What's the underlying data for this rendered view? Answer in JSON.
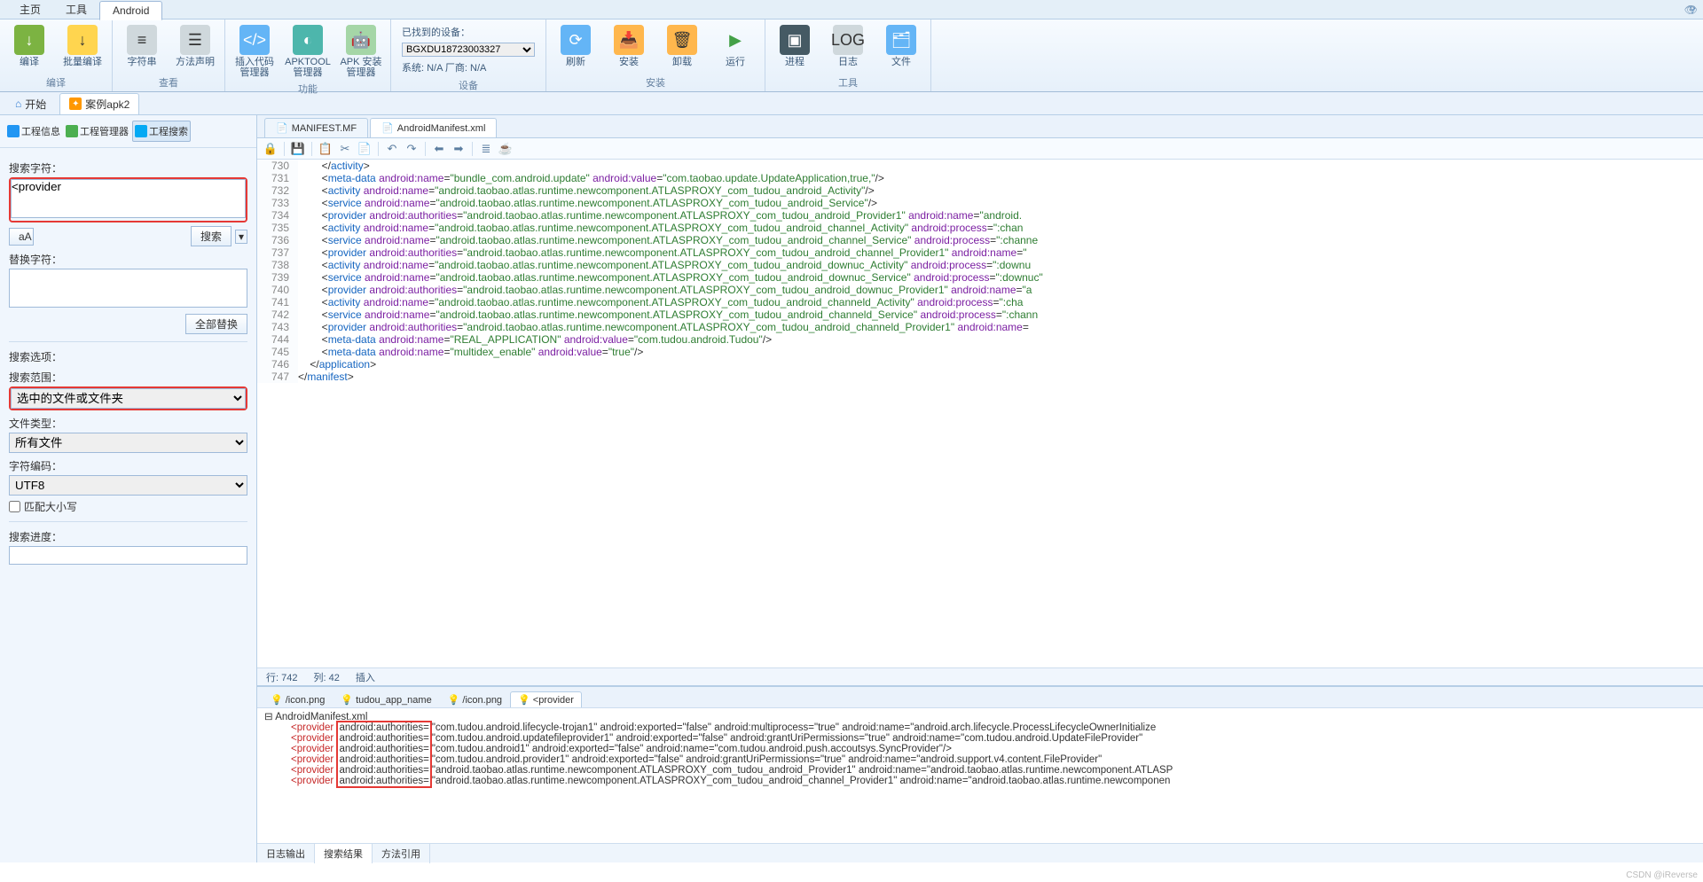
{
  "menu": {
    "home": "主页",
    "tools": "工具",
    "android": "Android"
  },
  "ribbon": {
    "groups": {
      "compile": "编译",
      "view": "查看",
      "func": "功能",
      "device": "设备",
      "install": "安装",
      "tools": "工具"
    },
    "btn": {
      "compile": "编译",
      "batch": "批量编译",
      "strings": "字符串",
      "method": "方法声明",
      "code": "插入代码管理器",
      "apktool": "APKTOOL管理器",
      "apkinst": "APK 安装管理器",
      "refresh": "刷新",
      "install": "安装",
      "uninstall": "卸载",
      "run": "运行",
      "process": "进程",
      "log": "日志",
      "file": "文件"
    },
    "device": {
      "label": "已找到的设备：",
      "selected": "BGXDU18723003327",
      "sys": "系统: N/A  厂商: N/A"
    }
  },
  "nav": {
    "start": "开始",
    "proj": "案例apk2"
  },
  "side": {
    "tabs": {
      "info": "工程信息",
      "mgr": "工程管理器",
      "search": "工程搜索"
    },
    "searchLabel": "搜索字符：",
    "searchValue": "<provider",
    "fontBtn": "aA",
    "searchBtn": "搜索",
    "replaceLabel": "替换字符：",
    "replaceAll": "全部替换",
    "optHeader": "搜索选项：",
    "scopeLabel": "搜索范围：",
    "scope": "选中的文件或文件夹",
    "ftypeLabel": "文件类型：",
    "ftype": "所有文件",
    "encLabel": "字符编码：",
    "enc": "UTF8",
    "matchcase": "匹配大小写",
    "progress": "搜索进度："
  },
  "files": {
    "tab1": "MANIFEST.MF",
    "tab2": "AndroidManifest.xml"
  },
  "status": {
    "row": "行: 742",
    "col": "列: 42",
    "mode": "插入"
  },
  "searchtabs": {
    "t1": "/icon.png",
    "t2": "tudou_app_name",
    "t3": "/icon.png",
    "t4": "<provider"
  },
  "resultFile": "AndroidManifest.xml",
  "results": [
    {
      "auth": "com.tudou.android.lifecycle-trojan1",
      "rest": "android:exported=\"false\" android:multiprocess=\"true\" android:name=\"android.arch.lifecycle.ProcessLifecycleOwnerInitialize"
    },
    {
      "auth": "com.tudou.android.updatefileprovider1",
      "rest": "android:exported=\"false\" android:grantUriPermissions=\"true\" android:name=\"com.tudou.android.UpdateFileProvider\""
    },
    {
      "auth": "com.tudou.android1",
      "rest": "android:exported=\"false\" android:name=\"com.tudou.android.push.accoutsys.SyncProvider\"/>"
    },
    {
      "auth": "com.tudou.android.provider1",
      "rest": "android:exported=\"false\" android:grantUriPermissions=\"true\" android:name=\"android.support.v4.content.FileProvider\""
    },
    {
      "auth": "android.taobao.atlas.runtime.newcomponent.ATLASPROXY_com_tudou_android_Provider1",
      "rest": "android:name=\"android.taobao.atlas.runtime.newcomponent.ATLASP"
    },
    {
      "auth": "android.taobao.atlas.runtime.newcomponent.ATLASPROXY_com_tudou_android_channel_Provider1",
      "rest": "android:name=\"android.taobao.atlas.runtime.newcomponen"
    }
  ],
  "bottomtabs": {
    "log": "日志输出",
    "res": "搜索结果",
    "ref": "方法引用"
  },
  "watermark": "CSDN @iReverse",
  "code": [
    {
      "n": 730,
      "h": "        &lt;/<span class='t-tag'>activity</span>&gt;"
    },
    {
      "n": 731,
      "h": "        &lt;<span class='t-tag'>meta-data</span> <span class='t-attr'>android:name</span>=<span class='t-str'>\"bundle_com.android.update\"</span> <span class='t-attr'>android:value</span>=<span class='t-str'>\"com.taobao.update.UpdateApplication,true,\"</span>/&gt;"
    },
    {
      "n": 732,
      "h": "        &lt;<span class='t-tag'>activity</span> <span class='t-attr'>android:name</span>=<span class='t-str'>\"android.taobao.atlas.runtime.newcomponent.ATLASPROXY_com_tudou_android_Activity\"</span>/&gt;"
    },
    {
      "n": 733,
      "h": "        &lt;<span class='t-tag'>service</span> <span class='t-attr'>android:name</span>=<span class='t-str'>\"android.taobao.atlas.runtime.newcomponent.ATLASPROXY_com_tudou_android_Service\"</span>/&gt;"
    },
    {
      "n": 734,
      "h": "        &lt;<span class='t-tag'>provider</span> <span class='t-attr'>android:authorities</span>=<span class='t-str'>\"android.taobao.atlas.runtime.newcomponent.ATLASPROXY_com_tudou_android_Provider1\"</span> <span class='t-attr'>android:name</span>=<span class='t-str'>\"android.</span>"
    },
    {
      "n": 735,
      "h": "        &lt;<span class='t-tag'>activity</span> <span class='t-attr'>android:name</span>=<span class='t-str'>\"android.taobao.atlas.runtime.newcomponent.ATLASPROXY_com_tudou_android_channel_Activity\"</span> <span class='t-attr'>android:process</span>=<span class='t-str'>\":chan</span>"
    },
    {
      "n": 736,
      "h": "        &lt;<span class='t-tag'>service</span> <span class='t-attr'>android:name</span>=<span class='t-str'>\"android.taobao.atlas.runtime.newcomponent.ATLASPROXY_com_tudou_android_channel_Service\"</span> <span class='t-attr'>android:process</span>=<span class='t-str'>\":channe</span>"
    },
    {
      "n": 737,
      "h": "        &lt;<span class='t-tag'>provider</span> <span class='t-attr'>android:authorities</span>=<span class='t-str'>\"android.taobao.atlas.runtime.newcomponent.ATLASPROXY_com_tudou_android_channel_Provider1\"</span> <span class='t-attr'>android:name</span>=<span class='t-str'>\"</span>"
    },
    {
      "n": 738,
      "h": "        &lt;<span class='t-tag'>activity</span> <span class='t-attr'>android:name</span>=<span class='t-str'>\"android.taobao.atlas.runtime.newcomponent.ATLASPROXY_com_tudou_android_downuc_Activity\"</span> <span class='t-attr'>android:process</span>=<span class='t-str'>\":downu</span>"
    },
    {
      "n": 739,
      "h": "        &lt;<span class='t-tag'>service</span> <span class='t-attr'>android:name</span>=<span class='t-str'>\"android.taobao.atlas.runtime.newcomponent.ATLASPROXY_com_tudou_android_downuc_Service\"</span> <span class='t-attr'>android:process</span>=<span class='t-str'>\":downuc\"</span>"
    },
    {
      "n": 740,
      "h": "        &lt;<span class='t-tag'>provider</span> <span class='t-attr'>android:authorities</span>=<span class='t-str'>\"android.taobao.atlas.runtime.newcomponent.ATLASPROXY_com_tudou_android_downuc_Provider1\"</span> <span class='t-attr'>android:name</span>=<span class='t-str'>\"a</span>"
    },
    {
      "n": 741,
      "h": "        &lt;<span class='t-tag'>activity</span> <span class='t-attr'>android:name</span>=<span class='t-str'>\"android.taobao.atlas.runtime.newcomponent.ATLASPROXY_com_tudou_android_channeld_Activity\"</span> <span class='t-attr'>android:process</span>=<span class='t-str'>\":cha</span>"
    },
    {
      "n": 742,
      "h": "        &lt;<span class='t-tag'>service</span> <span class='t-attr'>android:name</span>=<span class='t-str'>\"android.taobao.atlas.runtime.newcomponent.ATLASPROXY_com_tudou_android_channeld_Service\"</span> <span class='t-attr'>android:process</span>=<span class='t-str'>\":chann</span>"
    },
    {
      "n": 743,
      "h": "        &lt;<span class='t-tag'>provider</span> <span class='t-attr'>android:authorities</span>=<span class='t-str'>\"android.taobao.atlas.runtime.newcomponent.ATLASPROXY_com_tudou_android_channeld_Provider1\"</span> <span class='t-attr'>android:name</span>=<span class='t-str'></span>"
    },
    {
      "n": 744,
      "h": "        &lt;<span class='t-tag'>meta-data</span> <span class='t-attr'>android:name</span>=<span class='t-str'>\"REAL_APPLICATION\"</span> <span class='t-attr'>android:value</span>=<span class='t-str'>\"com.tudou.android.Tudou\"</span>/&gt;"
    },
    {
      "n": 745,
      "h": "        &lt;<span class='t-tag'>meta-data</span> <span class='t-attr'>android:name</span>=<span class='t-str'>\"multidex_enable\"</span> <span class='t-attr'>android:value</span>=<span class='t-str'>\"true\"</span>/&gt;"
    },
    {
      "n": 746,
      "h": "    &lt;/<span class='t-tag'>application</span>&gt;"
    },
    {
      "n": 747,
      "h": "&lt;/<span class='t-tag'>manifest</span>&gt;"
    }
  ]
}
